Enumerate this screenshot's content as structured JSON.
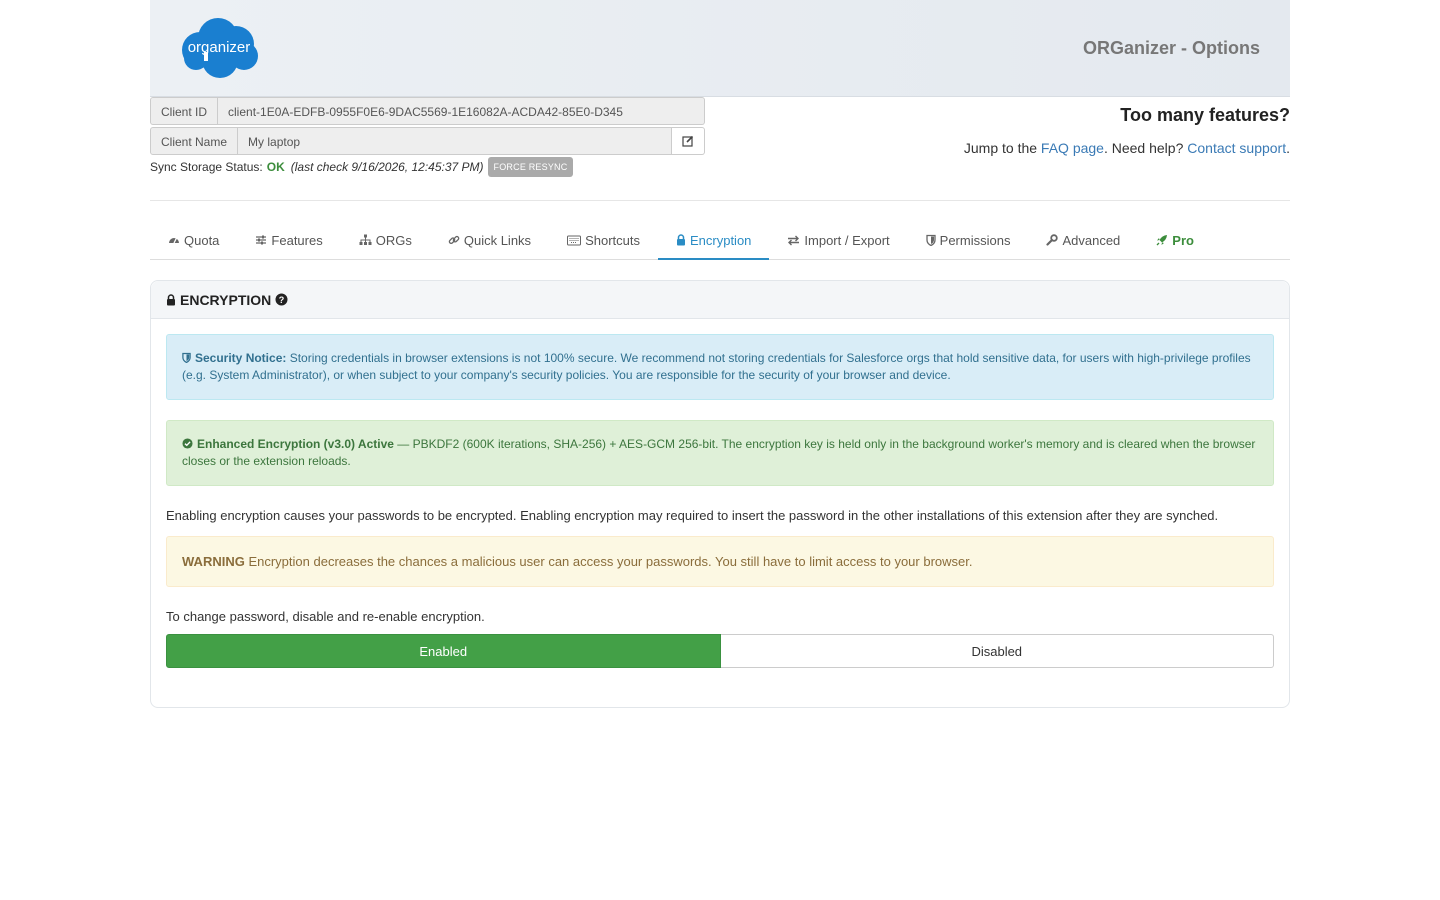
{
  "header": {
    "logo_text": "organizer",
    "title": "ORGanizer - Options"
  },
  "client": {
    "id_label": "Client ID",
    "id_value": "client-1E0A-EDFB-0955F0E6-9DAC5569-1E16082A-ACDA42-85E0-D345",
    "name_label": "Client Name",
    "name_value": "My laptop",
    "edit_icon": "edit-icon"
  },
  "sync": {
    "label": "Sync Storage Status:",
    "status": "OK",
    "last_check": "(last check 9/16/2026, 12:45:37 PM)",
    "force_resync": "FORCE RESYNC"
  },
  "help": {
    "heading": "Too many features?",
    "jump_prefix": "Jump to the ",
    "faq_link": "FAQ page",
    "need_help": ". Need help? ",
    "support_link": "Contact support",
    "end": "."
  },
  "tabs": [
    {
      "label": "Quota",
      "icon": "dashboard-icon"
    },
    {
      "label": "Features",
      "icon": "sliders-icon"
    },
    {
      "label": "ORGs",
      "icon": "sitemap-icon"
    },
    {
      "label": "Quick Links",
      "icon": "link-icon"
    },
    {
      "label": "Shortcuts",
      "icon": "keyboard-icon"
    },
    {
      "label": "Encryption",
      "icon": "lock-icon",
      "active": true
    },
    {
      "label": "Import / Export",
      "icon": "exchange-icon"
    },
    {
      "label": "Permissions",
      "icon": "shield-icon"
    },
    {
      "label": "Advanced",
      "icon": "wrench-icon"
    },
    {
      "label": "Pro",
      "icon": "rocket-icon"
    }
  ],
  "panel": {
    "title": "ENCRYPTION",
    "security_notice_label": "Security Notice:",
    "security_notice_text": " Storing credentials in browser extensions is not 100% secure. We recommend not storing credentials for Salesforce orgs that hold sensitive data, for users with high-privilege profiles (e.g. System Administrator), or when subject to your company's security policies. You are responsible for the security of your browser and device.",
    "enhanced_label": "Enhanced Encryption (v3.0) Active",
    "enhanced_text": " — PBKDF2 (600K iterations, SHA-256) + AES-GCM 256-bit. The encryption key is held only in the background worker's memory and is cleared when the browser closes or the extension reloads.",
    "description": "Enabling encryption causes your passwords to be encrypted. Enabling encryption may required to insert the password in the other installations of this extension after they are synched.",
    "warning_label": "WARNING",
    "warning_text": " Encryption decreases the chances a malicious user can access your passwords. You still have to limit access to your browser.",
    "change_password": "To change password, disable and re-enable encryption.",
    "enabled_label": "Enabled",
    "disabled_label": "Disabled"
  },
  "colors": {
    "accent": "#2a8cc4",
    "success": "#43a047",
    "logo": "#1a7fd0"
  }
}
